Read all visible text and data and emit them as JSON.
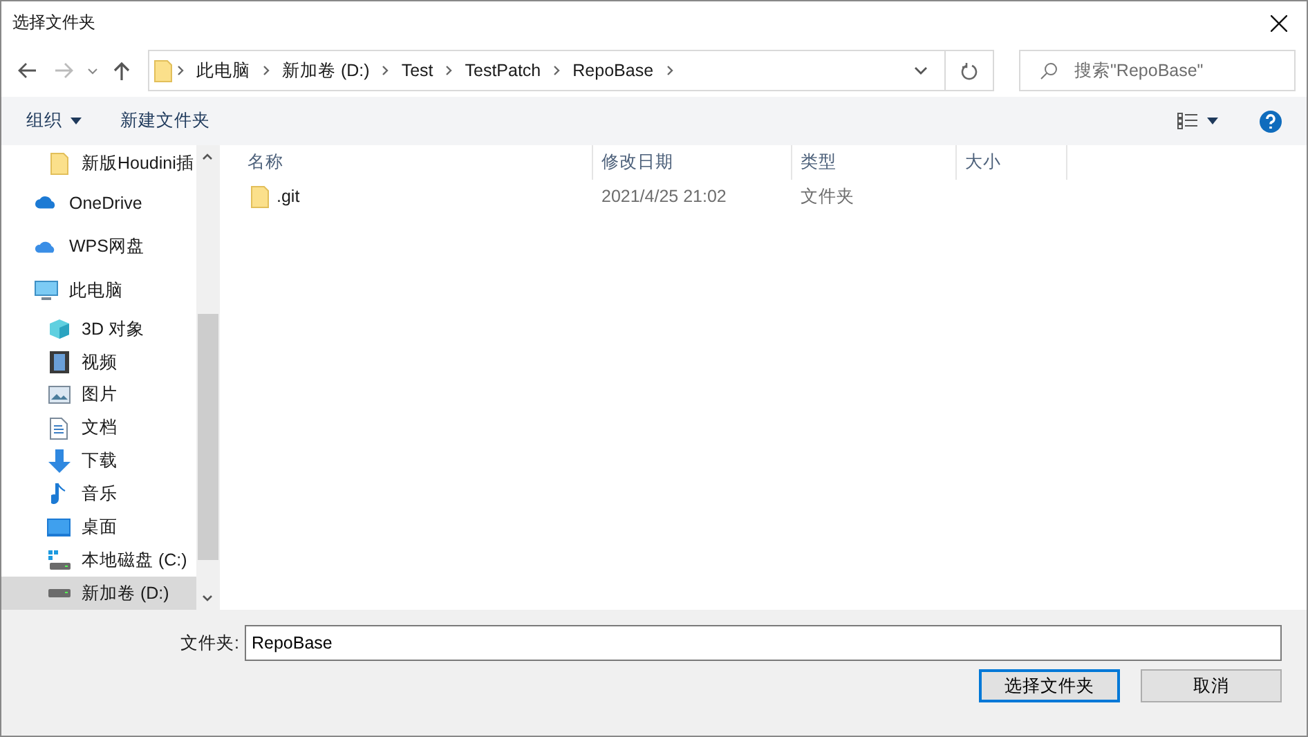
{
  "window": {
    "title": "选择文件夹"
  },
  "address_bar": {
    "path": [
      {
        "label": "此电脑"
      },
      {
        "label": "新加卷 (D:)"
      },
      {
        "label": "Test"
      },
      {
        "label": "TestPatch"
      },
      {
        "label": "RepoBase"
      }
    ]
  },
  "search": {
    "placeholder": "搜索\"RepoBase\""
  },
  "toolbar": {
    "organize": "组织",
    "new_folder": "新建文件夹"
  },
  "sidebar": {
    "items": [
      {
        "kind": "folder",
        "label": "新版Houdini插",
        "selected": false
      },
      {
        "kind": "onedrive",
        "label": "OneDrive",
        "selected": false
      },
      {
        "kind": "wps",
        "label": "WPS网盘",
        "selected": false
      },
      {
        "kind": "pc",
        "label": "此电脑",
        "selected": false,
        "children": [
          {
            "kind": "objects",
            "label": "3D 对象",
            "selected": false
          },
          {
            "kind": "video",
            "label": "视频",
            "selected": false
          },
          {
            "kind": "picture",
            "label": "图片",
            "selected": false
          },
          {
            "kind": "document",
            "label": "文档",
            "selected": false
          },
          {
            "kind": "download",
            "label": "下载",
            "selected": false
          },
          {
            "kind": "music",
            "label": "音乐",
            "selected": false
          },
          {
            "kind": "desktop",
            "label": "桌面",
            "selected": false
          },
          {
            "kind": "system-disk",
            "label": "本地磁盘 (C:)",
            "selected": false
          },
          {
            "kind": "disk",
            "label": "新加卷 (D:)",
            "selected": true
          }
        ]
      }
    ]
  },
  "table": {
    "columns": [
      "名称",
      "修改日期",
      "类型",
      "大小"
    ],
    "rows": [
      {
        "name": ".git",
        "modified": "2021/4/25 21:02",
        "type": "文件夹",
        "selected": false
      }
    ]
  },
  "footer": {
    "folder_label": "文件夹:",
    "folder_value": "RepoBase",
    "buttons": [
      {
        "label": "选择文件夹",
        "kind": "primary"
      },
      {
        "label": "取消",
        "kind": "normal"
      }
    ]
  }
}
